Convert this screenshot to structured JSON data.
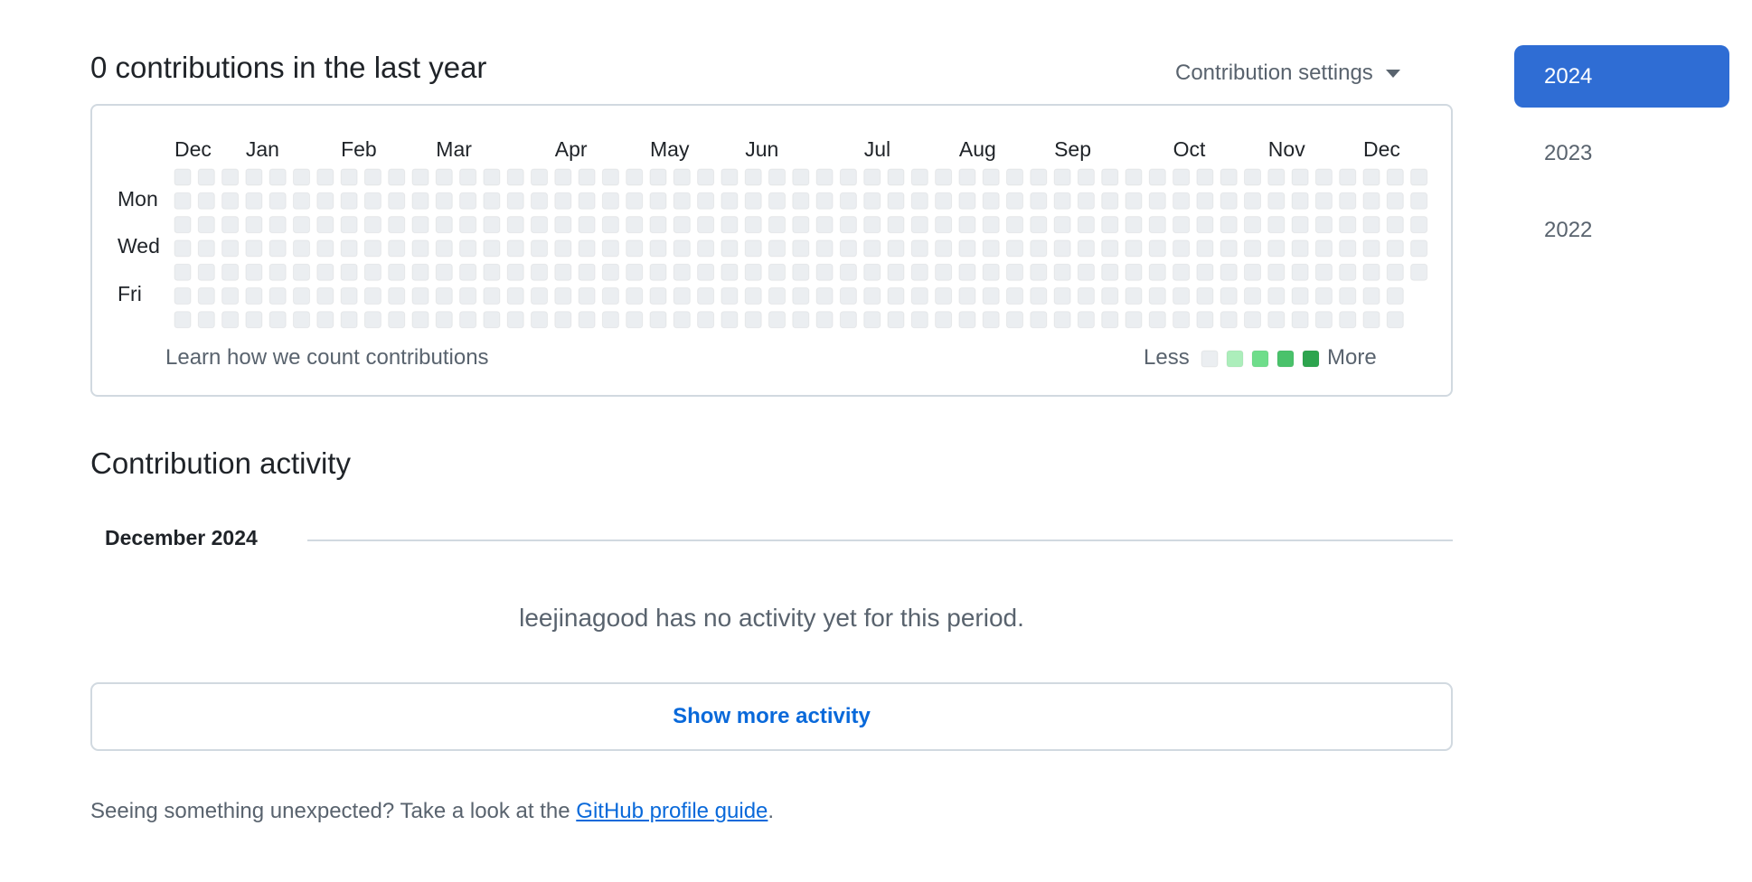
{
  "header": {
    "title": "0 contributions in the last year",
    "settings_label": "Contribution settings"
  },
  "graph": {
    "months": [
      "Dec",
      "Jan",
      "Feb",
      "Mar",
      "Apr",
      "May",
      "Jun",
      "Jul",
      "Aug",
      "Sep",
      "Oct",
      "Nov",
      "Dec"
    ],
    "month_week_index": [
      0,
      3,
      7,
      11,
      16,
      20,
      24,
      29,
      33,
      37,
      42,
      46,
      50
    ],
    "days": [
      "Mon",
      "Wed",
      "Fri"
    ],
    "weeks": 53,
    "last_week_days": 5,
    "contributions_total": 0,
    "learn_link": "Learn how we count contributions",
    "legend": {
      "less": "Less",
      "more": "More",
      "colors": [
        "#ebeef1",
        "#aceebb",
        "#6fdd8b",
        "#4ac26b",
        "#2da44e"
      ]
    },
    "empty_cell_color": "#ebeef1"
  },
  "activity": {
    "title": "Contribution activity",
    "month": "December 2024",
    "empty_message": "leejinagood has no activity yet for this period.",
    "show_more": "Show more activity"
  },
  "footer": {
    "text": "Seeing something unexpected? Take a look at the",
    "link": "GitHub profile guide",
    "suffix": "."
  },
  "years": [
    {
      "label": "2024",
      "selected": true
    },
    {
      "label": "2023",
      "selected": false
    },
    {
      "label": "2022",
      "selected": false
    }
  ],
  "colors": {
    "accent": "#2f6dd4",
    "link": "#0969da",
    "border": "#d1d9e0"
  }
}
